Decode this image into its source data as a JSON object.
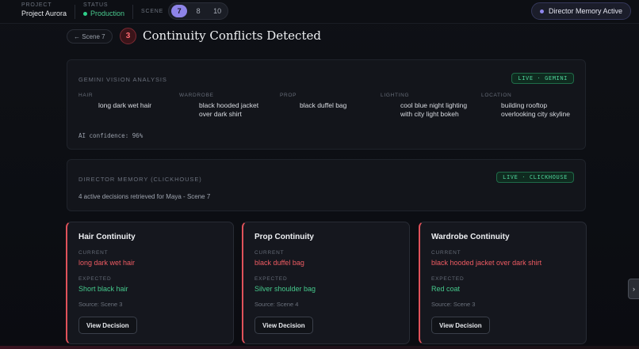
{
  "topbar": {
    "project_label": "PROJECT",
    "project_value": "Project Aurora",
    "status_label": "STATUS",
    "status_value": "Production",
    "scene_label": "SCENE",
    "scenes": [
      "7",
      "8",
      "10"
    ],
    "active_scene": "7",
    "director_memory": "Director Memory Active"
  },
  "header": {
    "back_label": "← Scene 7",
    "conflict_count": "3",
    "title": "Continuity Conflicts Detected"
  },
  "gemini": {
    "title": "GEMINI VISION ANALYSIS",
    "badge": "LIVE · GEMINI",
    "attributes": [
      {
        "label": "HAIR",
        "value_line1": "long dark wet hair",
        "value_line2": ""
      },
      {
        "label": "WARDROBE",
        "value_line1": "black hooded jacket",
        "value_line2": "over dark shirt"
      },
      {
        "label": "PROP",
        "value_line1": "black duffel bag",
        "value_line2": ""
      },
      {
        "label": "LIGHTING",
        "value_line1": "cool blue night lighting",
        "value_line2": "with city light bokeh"
      },
      {
        "label": "LOCATION",
        "value_line1": "building rooftop",
        "value_line2": "overlooking city skyline"
      }
    ],
    "confidence": "AI confidence: 96%"
  },
  "memory": {
    "title": "DIRECTOR MEMORY (CLICKHOUSE)",
    "badge": "LIVE · CLICKHOUSE",
    "text": "4 active decisions retrieved for Maya - Scene 7"
  },
  "cards": [
    {
      "title": "Hair Continuity",
      "current_label": "CURRENT",
      "current": "long dark wet hair",
      "expected_label": "EXPECTED",
      "expected": "Short black hair",
      "source": "Source: Scene 3",
      "button": "View Decision"
    },
    {
      "title": "Prop Continuity",
      "current_label": "CURRENT",
      "current": "black duffel bag",
      "expected_label": "EXPECTED",
      "expected": "Silver shoulder bag",
      "source": "Source: Scene 4",
      "button": "View Decision"
    },
    {
      "title": "Wardrobe Continuity",
      "current_label": "CURRENT",
      "current": "black hooded jacket over dark shirt",
      "expected_label": "EXPECTED",
      "expected": "Red coat",
      "source": "Source: Scene 3",
      "button": "View Decision"
    }
  ],
  "side_handle": "›",
  "colors": {
    "accent": "#8e84e8",
    "live_green": "#4fd39a",
    "conflict_red": "#ee5b62",
    "expected_green": "#45c98c"
  }
}
